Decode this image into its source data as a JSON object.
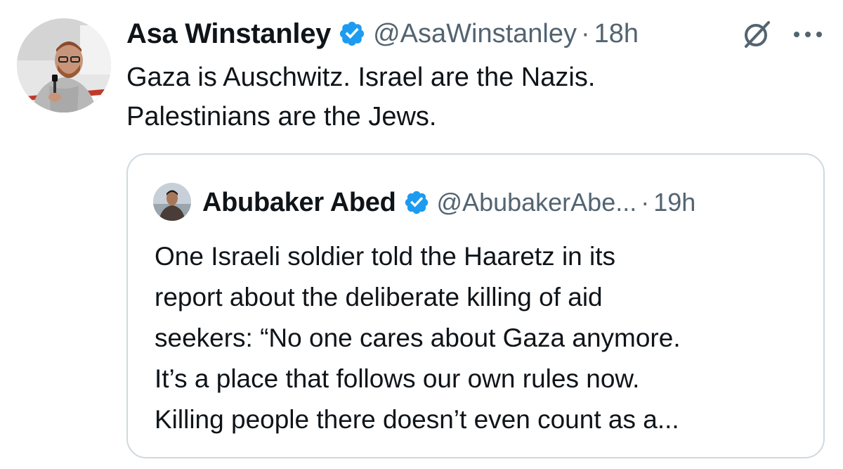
{
  "tweet": {
    "author": {
      "display_name": "Asa Winstanley",
      "handle": "@AsaWinstanley",
      "verified": true
    },
    "separator": "·",
    "timestamp": "18h",
    "text_lines": [
      "Gaza is Auschwitz. Israel are the Nazis.",
      "Palestinians are the Jews."
    ],
    "icons": [
      "verified-badge-icon",
      "grok-icon",
      "more-options-icon"
    ]
  },
  "quoted_tweet": {
    "author": {
      "display_name": "Abubaker Abed",
      "handle": "@AbubakerAbe...",
      "verified": true
    },
    "separator": "·",
    "timestamp": "19h",
    "text_lines": [
      "One Israeli soldier told the Haaretz in its",
      "report about the deliberate killing of aid",
      "seekers: “No one cares about Gaza anymore.",
      "It’s a place that follows our own rules now.",
      "Killing people there doesn’t even count as a..."
    ]
  },
  "colors": {
    "text_primary": "#0f1419",
    "text_secondary": "#536471",
    "verified_blue": "#1d9bf0",
    "border": "#cfd9de"
  }
}
